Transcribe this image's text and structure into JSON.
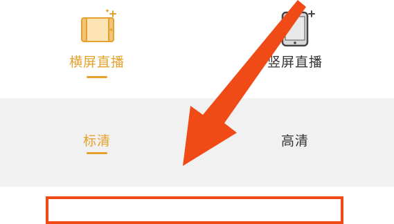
{
  "broadcast_mode": {
    "options": [
      {
        "label": "横屏直播",
        "icon": "landscape-phone-icon",
        "selected": true
      },
      {
        "label": "竖屏直播",
        "icon": "portrait-phone-icon",
        "selected": false
      }
    ]
  },
  "quality": {
    "options": [
      {
        "label": "标清",
        "selected": true
      },
      {
        "label": "高清",
        "selected": false
      }
    ]
  },
  "colors": {
    "accent": "#e5a12c",
    "inactive_text": "#333333",
    "quality_background": "#f1f1f1",
    "annotation": "#f04a17"
  },
  "annotation": {
    "icon": "pointer-arrow-icon"
  }
}
